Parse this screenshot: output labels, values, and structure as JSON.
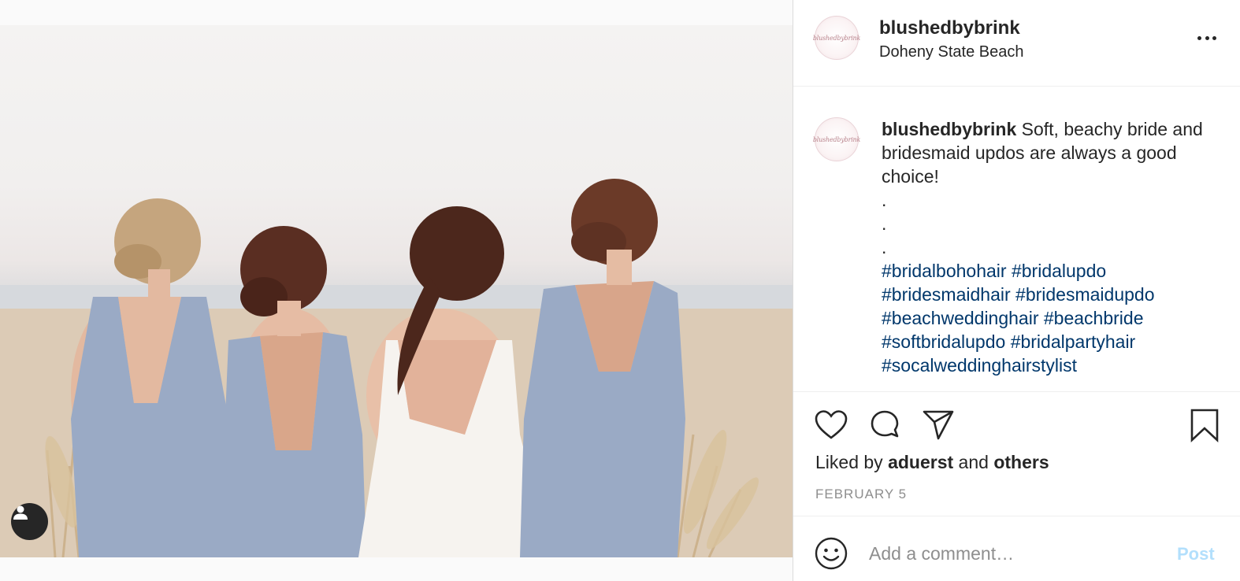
{
  "post": {
    "username": "blushedbybrink",
    "location": "Doheny State Beach",
    "avatar_text": "blushedbybrink",
    "photo_alt": "Bride and three bridesmaids seen from behind on a beach",
    "caption": {
      "username": "blushedbybrink",
      "text": "Soft, beachy bride and bridesmaid updos are always a good choice!",
      "dots": [
        ".",
        ".",
        "."
      ],
      "hashtags": [
        "#bridalbohohair",
        "#bridalupdo",
        "#bridesmaidhair",
        "#bridesmaidupdo",
        "#beachweddinghair",
        "#beachbride",
        "#softbridalupdo",
        "#bridalpartyhair",
        "#socalweddinghairstylist"
      ]
    },
    "likes": {
      "prefix": "Liked by",
      "user": "aduerst",
      "conjunction": "and",
      "others": "others"
    },
    "date": "FEBRUARY 5"
  },
  "comment": {
    "placeholder": "Add a comment…",
    "post_label": "Post"
  },
  "icons": {
    "like": "heart-icon",
    "comment": "comment-icon",
    "share": "paper-plane-icon",
    "save": "bookmark-icon",
    "more": "more-dots-icon",
    "emoji": "emoji-icon",
    "user_tag": "user-icon"
  },
  "colors": {
    "hashtag": "#00376b",
    "post_button_disabled": "#b2dffc",
    "secondary_text": "#8e8e8e",
    "dress_blue": "#9aaac5"
  }
}
